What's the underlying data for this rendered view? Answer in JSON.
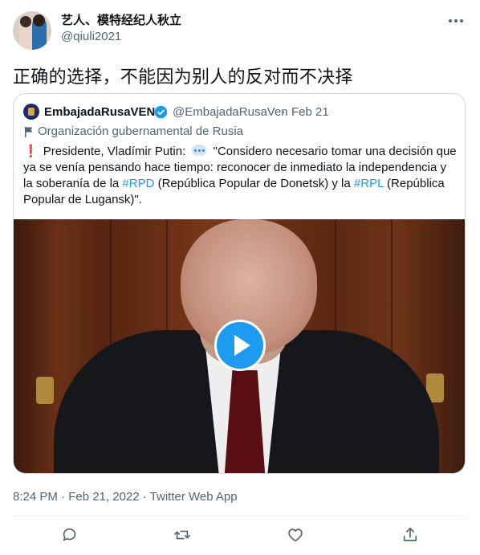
{
  "author": {
    "name": "艺人、模特经纪人秋立",
    "handle": "@qiuli2021"
  },
  "tweet": {
    "text": "正确的选择，不能因为别人的反对而不决择"
  },
  "quoted": {
    "name": "EmbajadaRusaVEN",
    "handle": "@EmbajadaRusaVen",
    "dot": "·",
    "date": "Feb 21",
    "label": "Organización gubernamental de Rusia",
    "intro": "Presidente, Vladímir Putin:",
    "text_a": " \"Considero necesario tomar una decisión que ya se venía pensando hace tiempo: reconocer de inmediato la independencia y la soberanía de la ",
    "hashtag1": "#RPD",
    "text_b": " (República Popular de Donetsk) y la ",
    "hashtag2": "#RPL",
    "text_c": " (República Popular de Lugansk)\"."
  },
  "meta": {
    "timestamp": "8:24 PM · Feb 21, 2022 · Twitter Web App"
  },
  "icons": [
    "more-icon",
    "verified-icon",
    "flag-icon",
    "play-icon",
    "reply-icon",
    "retweet-icon",
    "like-icon",
    "share-icon"
  ],
  "colors": {
    "accent": "#1d9bf0",
    "secondary_text": "#536471",
    "border": "#cfd9de"
  }
}
